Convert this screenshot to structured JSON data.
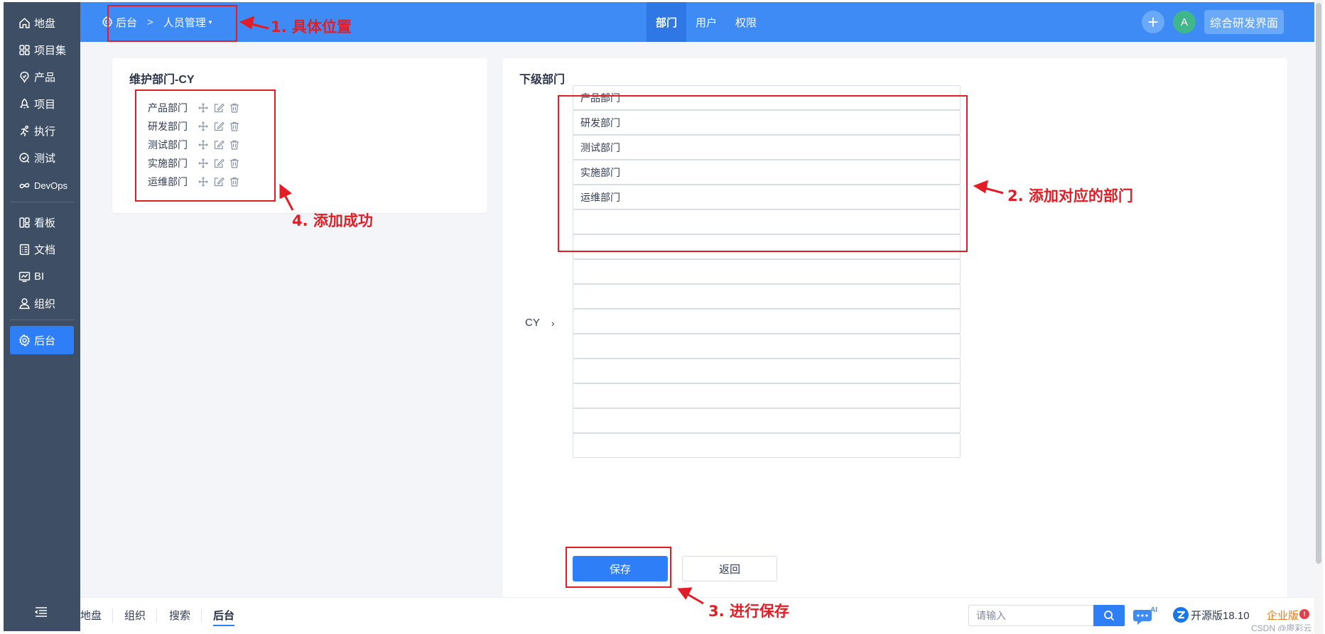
{
  "sidebar": {
    "items": [
      {
        "label": "地盘",
        "icon": "home-icon"
      },
      {
        "label": "项目集",
        "icon": "grid-icon"
      },
      {
        "label": "产品",
        "icon": "product-icon"
      },
      {
        "label": "项目",
        "icon": "project-icon"
      },
      {
        "label": "执行",
        "icon": "run-icon"
      },
      {
        "label": "测试",
        "icon": "test-icon"
      },
      {
        "label": "DevOps",
        "icon": "infinity-icon"
      },
      {
        "label": "看板",
        "icon": "kanban-icon"
      },
      {
        "label": "文档",
        "icon": "doc-icon"
      },
      {
        "label": "BI",
        "icon": "chart-icon"
      },
      {
        "label": "组织",
        "icon": "user-icon"
      },
      {
        "label": "后台",
        "icon": "gear-icon",
        "active": true
      }
    ]
  },
  "header": {
    "breadcrumb_root": "后台",
    "breadcrumb_current": "人员管理",
    "tabs": [
      "部门",
      "用户",
      "权限"
    ],
    "avatar_letter": "A",
    "plus_label": "+",
    "switch_button": "综合研发界面"
  },
  "left_card": {
    "title": "维护部门-CY",
    "tree": [
      "产品部门",
      "研发部门",
      "测试部门",
      "实施部门",
      "运维部门"
    ]
  },
  "right_card": {
    "title": "下级部门",
    "parent_label": "CY",
    "parent_chevron": "›",
    "inputs": [
      "产品部门",
      "研发部门",
      "测试部门",
      "实施部门",
      "运维部门",
      "",
      "",
      "",
      "",
      "",
      "",
      "",
      "",
      "",
      ""
    ],
    "save_label": "保存",
    "back_label": "返回"
  },
  "bottom": {
    "tabs": [
      "地盘",
      "组织",
      "搜索",
      "后台"
    ],
    "active_tab": "后台",
    "search_placeholder": "请输入",
    "ai_label": "AI",
    "version": "开源版18.10",
    "enterprise": "企业版",
    "badge": "!",
    "watermark": "CSDN @廖彩云"
  },
  "annotations": {
    "a1": "1. 具体位置",
    "a2": "2. 添加对应的部门",
    "a3": "3. 进行保存",
    "a4": "4. 添加成功",
    "color": "#e11d26"
  },
  "colors": {
    "sidebar": "#3e4f65",
    "header": "#3f8bf6",
    "primary": "#2e7ff7",
    "background": "#f3f5f8"
  }
}
